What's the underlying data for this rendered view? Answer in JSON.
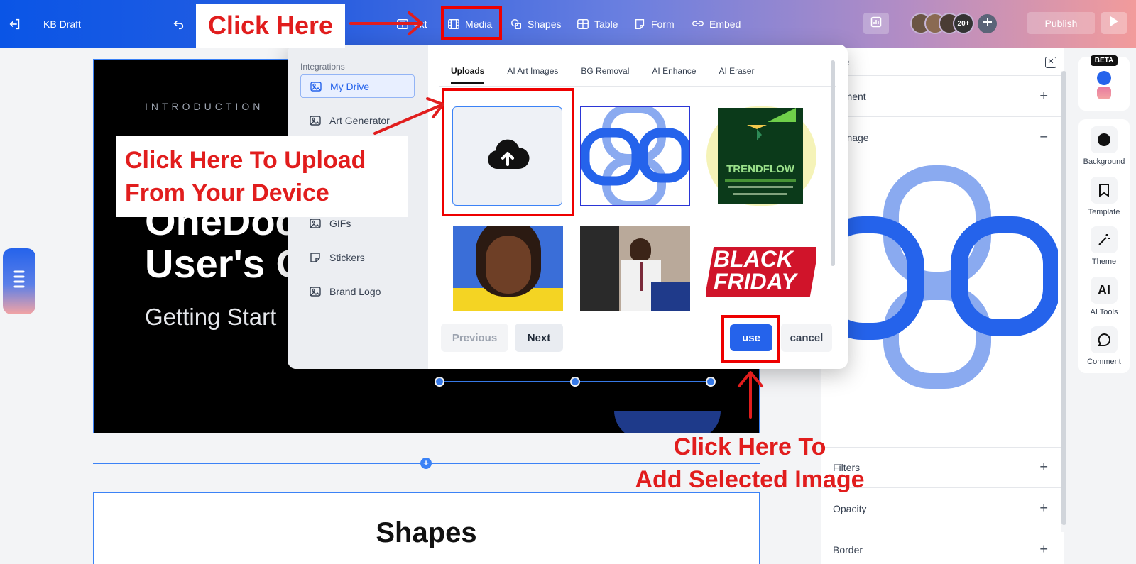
{
  "header": {
    "doc_title": "KB Draft",
    "menu": [
      {
        "label": "Text",
        "shown": "ext",
        "icon": "text-icon"
      },
      {
        "label": "Media",
        "icon": "media-icon"
      },
      {
        "label": "Shapes",
        "icon": "shapes-icon"
      },
      {
        "label": "Table",
        "icon": "table-icon"
      },
      {
        "label": "Form",
        "icon": "form-icon"
      },
      {
        "label": "Embed",
        "icon": "embed-icon"
      }
    ],
    "collaborator_count": "20+",
    "publish_label": "Publish"
  },
  "slide": {
    "intro": "INTRODUCTION",
    "title_line1": "OneDoc",
    "title_line2": "User's G",
    "subtitle": "Getting Start"
  },
  "slide2": {
    "title": "Shapes"
  },
  "media_popup": {
    "integrations_label": "Integrations",
    "sidebar": [
      {
        "label": "My Drive",
        "active": true
      },
      {
        "label": "Art Generator"
      },
      {
        "label": "GIFs"
      },
      {
        "label": "Stickers"
      },
      {
        "label": "Brand Logo"
      }
    ],
    "tabs": [
      "Uploads",
      "AI Art Images",
      "BG Removal",
      "AI Enhance",
      "AI Eraser"
    ],
    "active_tab": "Uploads",
    "thumb_trendflow": "TRENDFLOW",
    "thumb_blackfriday_1": "BLACK",
    "thumb_blackfriday_2": "FRIDAY",
    "previous_label": "Previous",
    "next_label": "Next",
    "use_label": "use",
    "cancel_label": "cancel"
  },
  "properties": {
    "header": "age",
    "alignment": "gnment",
    "crop_image": "p Image",
    "filters": "Filters",
    "opacity": "Opacity",
    "border": "Border"
  },
  "tools": {
    "beta": "BETA",
    "items": [
      "Background",
      "Template",
      "Theme",
      "AI Tools",
      "Comment"
    ],
    "ai_glyph": "AI"
  },
  "annotations": {
    "click_here": "Click Here",
    "upload_line1": "Click Here To Upload",
    "upload_line2": "From Your Device",
    "add_line1": "Click Here To",
    "add_line2": "Add Selected Image"
  },
  "colors": {
    "brand_blue": "#2563eb",
    "annotation_red": "#e11d1d"
  }
}
